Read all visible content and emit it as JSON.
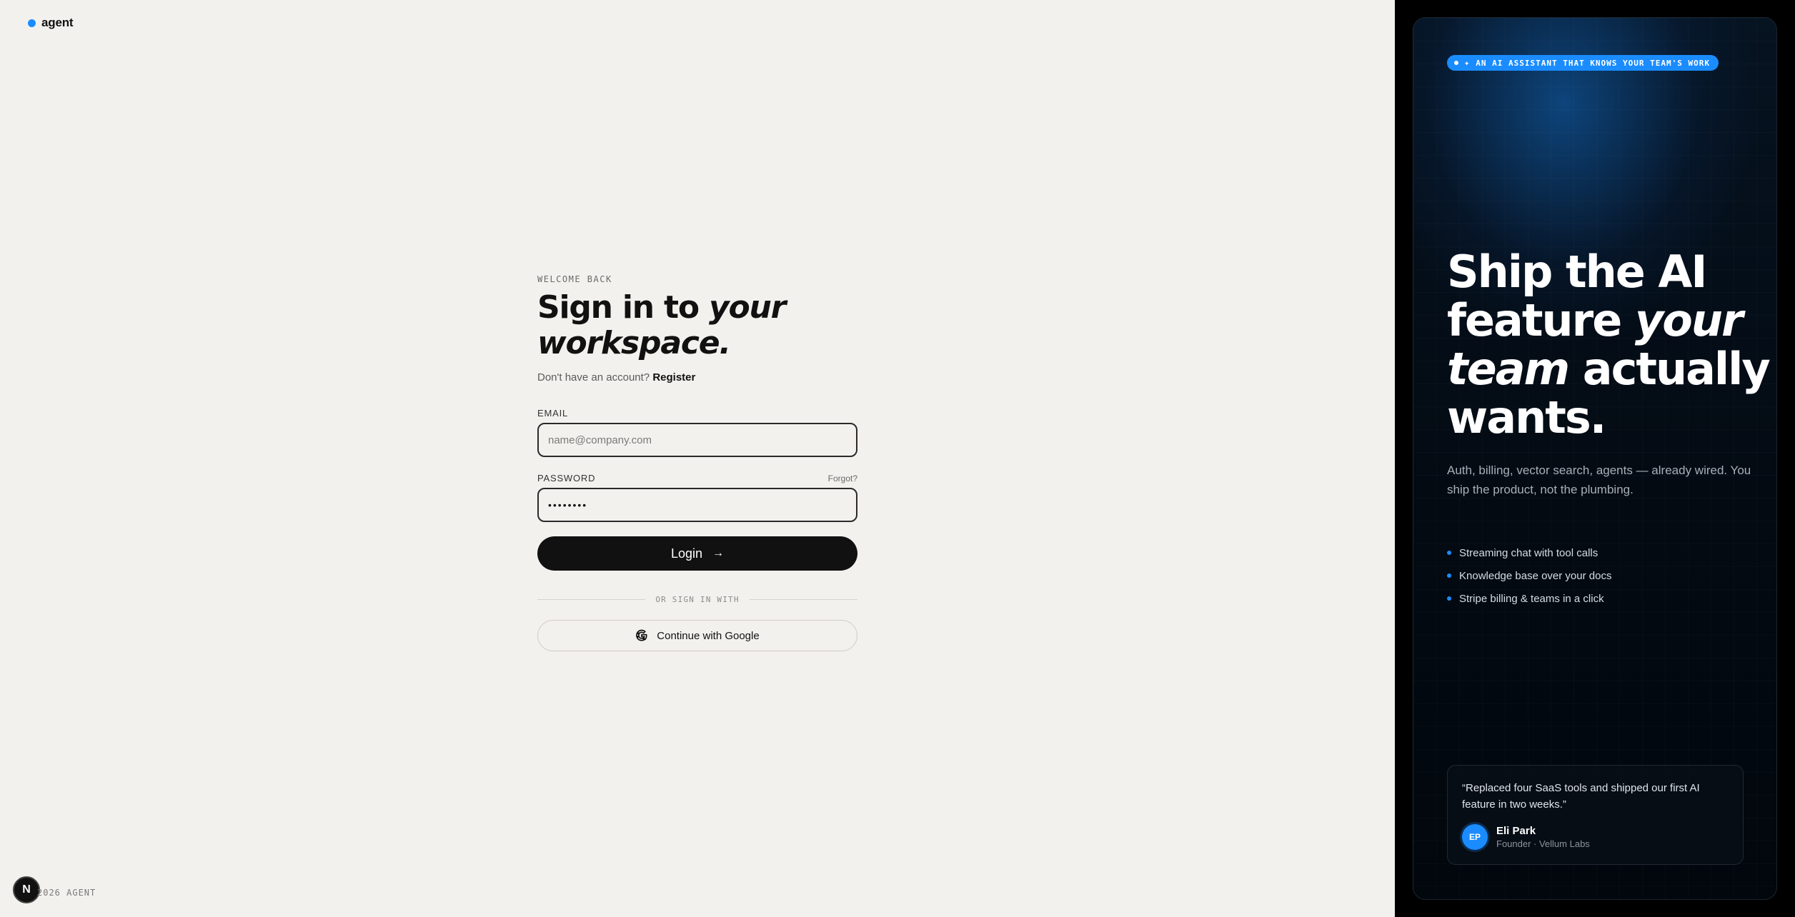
{
  "brand": {
    "name": "agent",
    "accent": "#1a8cff"
  },
  "form": {
    "eyebrow": "WELCOME BACK",
    "title_plain": "Sign in to ",
    "title_italic": "your workspace.",
    "subline_text": "Don't have an account?",
    "register_link": "Register",
    "email_label": "EMAIL",
    "email_placeholder": "name@company.com",
    "password_label": "PASSWORD",
    "forgot_link": "Forgot?",
    "password_value": "••••••••",
    "login_button": "Login",
    "divider_text": "OR SIGN IN WITH",
    "google_button": "Continue with Google"
  },
  "footer": {
    "badge": "N",
    "copyright": "2026 AGENT"
  },
  "promo": {
    "pill": "AN AI ASSISTANT THAT KNOWS YOUR TEAM'S WORK",
    "hero_1": "Ship the AI feature ",
    "hero_italic": "your team",
    "hero_2": " actually wants.",
    "sub": "Auth, billing, vector search, agents — already wired. You ship the product, not the plumbing.",
    "bullets": [
      "Streaming chat with tool calls",
      "Knowledge base over your docs",
      "Stripe billing & teams in a click"
    ],
    "testimonial": {
      "quote": "“Replaced four SaaS tools and shipped our first AI feature in two weeks.”",
      "initials": "EP",
      "name": "Eli Park",
      "role": "Founder · Vellum Labs"
    }
  }
}
